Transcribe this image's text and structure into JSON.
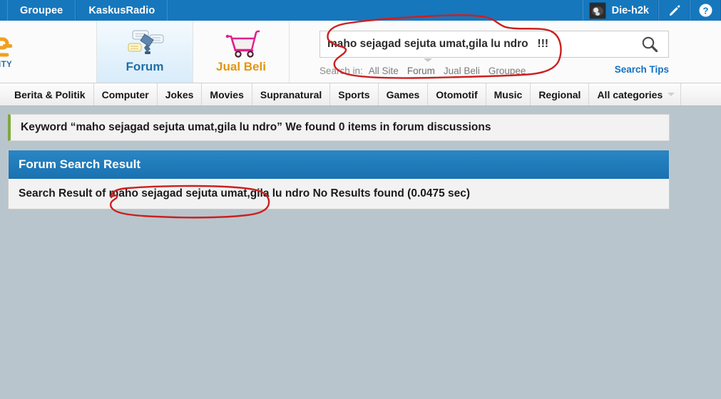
{
  "topbar": {
    "links": [
      {
        "label": "Groupee"
      },
      {
        "label": "KaskusRadio"
      }
    ],
    "username": "Die-h2k",
    "compose_icon": "pencil-icon",
    "help_icon": "help-icon",
    "avatar_icon": "user-avatar",
    "background_color": "#1677bd"
  },
  "header": {
    "brand_sub": "ITY",
    "tabs": [
      {
        "label": "Forum",
        "icon": "forum-satellite-icon",
        "active": true
      },
      {
        "label": "Jual Beli",
        "icon": "shopping-cart-icon",
        "active": false
      }
    ]
  },
  "search": {
    "value": "maho sejagad sejuta umat,gila lu ndro   !!!",
    "placeholder": "",
    "button_icon": "search-magnifier-icon",
    "search_in_label": "Search in:",
    "options": [
      {
        "label": "All Site",
        "selected": false
      },
      {
        "label": "Forum",
        "selected": true
      },
      {
        "label": "Jual Beli",
        "selected": false
      },
      {
        "label": "Groupee",
        "selected": false
      }
    ],
    "tips_label": "Search Tips",
    "tips_color": "#1371c1"
  },
  "categories": {
    "items": [
      {
        "label": "Berita & Politik"
      },
      {
        "label": "Computer"
      },
      {
        "label": "Jokes"
      },
      {
        "label": "Movies"
      },
      {
        "label": "Supranatural"
      },
      {
        "label": "Sports"
      },
      {
        "label": "Games"
      },
      {
        "label": "Otomotif"
      },
      {
        "label": "Music"
      },
      {
        "label": "Regional"
      }
    ],
    "all_label": "All categories"
  },
  "results": {
    "keyword_notice": "Keyword “maho sejagad sejuta umat,gila lu ndro” We found 0 items in forum discussions",
    "panel_title": "Forum Search Result",
    "panel_body": "Search Result of maho sejagad sejuta umat,gila lu ndro No Results found (0.0475 sec)",
    "accent_color": "#7fa83c",
    "panel_header_color": "#1971b0"
  },
  "annotations": {
    "color": "#cc1f1f",
    "marks": [
      {
        "name": "search-box-circle",
        "target": "search input text"
      },
      {
        "name": "result-keyword-circle",
        "target": "search result keyword"
      }
    ]
  },
  "page": {
    "background_color": "#b9c5cc"
  }
}
